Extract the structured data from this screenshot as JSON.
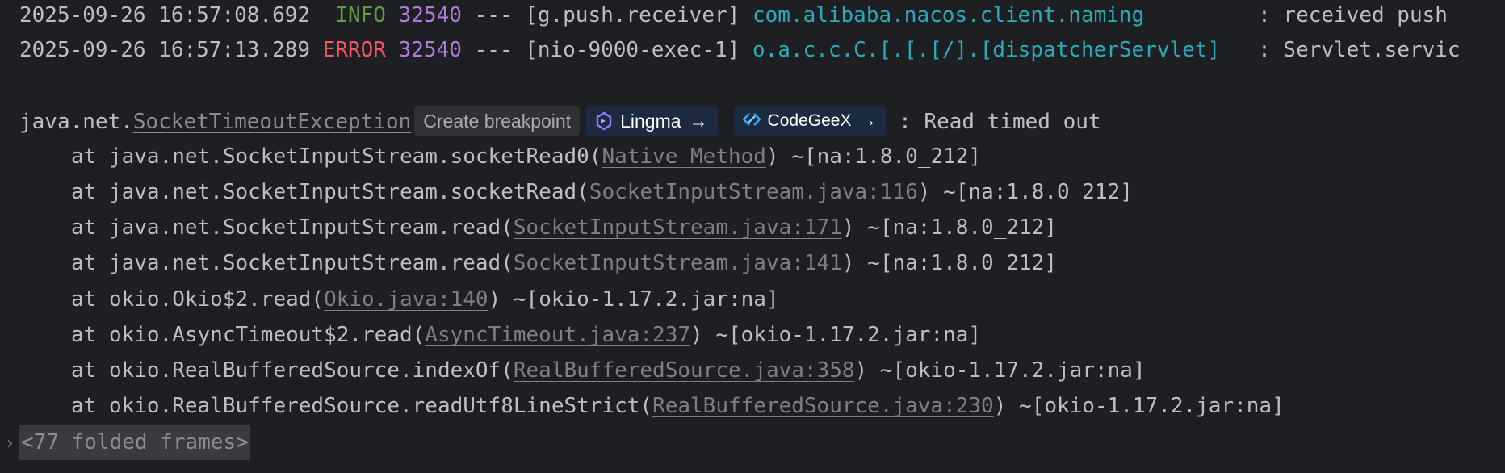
{
  "log_lines": [
    {
      "timestamp": "2025-09-26 16:57:08.692",
      "level": " INFO",
      "pid": "32540",
      "separator": "---",
      "thread": "[g.push.receiver]",
      "logger": "com.alibaba.nacos.client.naming",
      "logger_pad": "         ",
      "message": ": received push"
    },
    {
      "timestamp": "2025-09-26 16:57:13.289",
      "level": "ERROR",
      "pid": "32540",
      "separator": "---",
      "thread": "[nio-9000-exec-1]",
      "logger": "o.a.c.c.C.[.[.[/].[dispatcherServlet]",
      "logger_pad": "   ",
      "message": ": Servlet.servic"
    }
  ],
  "exception": {
    "package": "java.net.",
    "class_link": "SocketTimeoutException",
    "message": " : Read timed out",
    "breakpoint_hint": "Create breakpoint",
    "ai_buttons": [
      {
        "label": "Lingma",
        "icon": "lingma-icon",
        "arrow": "→"
      },
      {
        "label": "CodeGeeX",
        "icon": "codegeex-icon",
        "arrow": "→"
      }
    ]
  },
  "stack_frames": [
    {
      "prefix": "at java.net.SocketInputStream.socketRead0(",
      "link": "Native Method",
      "suffix": ") ~[na:1.8.0_212]"
    },
    {
      "prefix": "at java.net.SocketInputStream.socketRead(",
      "link": "SocketInputStream.java:116",
      "suffix": ") ~[na:1.8.0_212]"
    },
    {
      "prefix": "at java.net.SocketInputStream.read(",
      "link": "SocketInputStream.java:171",
      "suffix": ") ~[na:1.8.0_212]"
    },
    {
      "prefix": "at java.net.SocketInputStream.read(",
      "link": "SocketInputStream.java:141",
      "suffix": ") ~[na:1.8.0_212]"
    },
    {
      "prefix": "at okio.Okio$2.read(",
      "link": "Okio.java:140",
      "suffix": ") ~[okio-1.17.2.jar:na]"
    },
    {
      "prefix": "at okio.AsyncTimeout$2.read(",
      "link": "AsyncTimeout.java:237",
      "suffix": ") ~[okio-1.17.2.jar:na]"
    },
    {
      "prefix": "at okio.RealBufferedSource.indexOf(",
      "link": "RealBufferedSource.java:358",
      "suffix": ") ~[okio-1.17.2.jar:na]"
    },
    {
      "prefix": "at okio.RealBufferedSource.readUtf8LineStrict(",
      "link": "RealBufferedSource.java:230",
      "suffix": ") ~[okio-1.17.2.jar:na]"
    }
  ],
  "folded": {
    "chevron": "›",
    "label": "<77 folded frames>"
  },
  "colors": {
    "background": "#1e1f22",
    "info": "#5f9b45",
    "error": "#f75464",
    "pid": "#b07cd8",
    "logger": "#2aacb8",
    "text": "#bcbec4"
  }
}
